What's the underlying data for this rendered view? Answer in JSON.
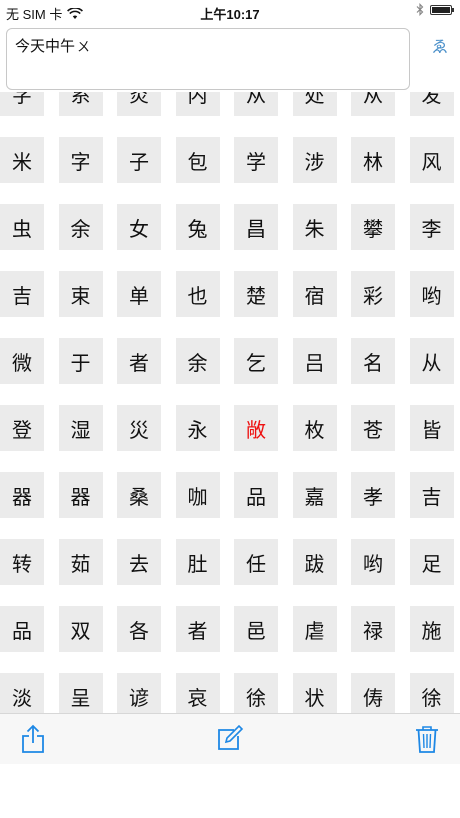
{
  "status": {
    "carrier": "无 SIM 卡",
    "time": "上午10:17"
  },
  "input": {
    "text": "今天中午",
    "trailing_glyph": "ㄨ"
  },
  "side_glyph": "ゑ",
  "grid": {
    "glyphs": [
      "字",
      "系",
      "炎",
      "内",
      "从",
      "处",
      "从",
      "发",
      "米",
      "字",
      "子",
      "包",
      "学",
      "涉",
      "林",
      "风",
      "虫",
      "余",
      "女",
      "兔",
      "昌",
      "朱",
      "攀",
      "李",
      "吉",
      "束",
      "单",
      "也",
      "楚",
      "宿",
      "彩",
      "哟",
      "微",
      "于",
      "者",
      "余",
      "乞",
      "吕",
      "名",
      "从",
      "登",
      "湿",
      "災",
      "永",
      "敞",
      "枚",
      "苍",
      "皆",
      "器",
      "器",
      "桑",
      "咖",
      "品",
      "嘉",
      "孝",
      "吉",
      "转",
      "茹",
      "去",
      "肚",
      "任",
      "跋",
      "哟",
      "足",
      "品",
      "双",
      "各",
      "者",
      "邑",
      "虐",
      "禄",
      "施",
      "淡",
      "呈",
      "谚",
      "哀",
      "徐",
      "状",
      "俦",
      "徐"
    ],
    "highlight_index": 44,
    "highlight_color": "#ee1111"
  },
  "toolbar": {
    "accent": "#1e88e5",
    "share_icon": "share-icon",
    "compose_icon": "compose-icon",
    "trash_icon": "trash-icon"
  }
}
